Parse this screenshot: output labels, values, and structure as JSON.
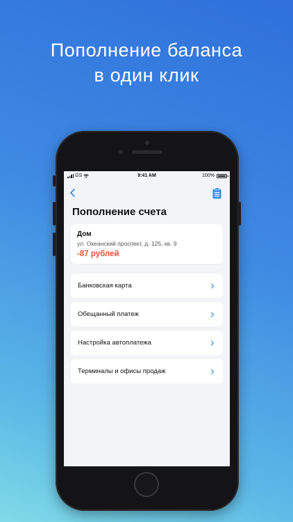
{
  "headline": {
    "line1": "Пополнение баланса",
    "line2": "в один клик"
  },
  "status_bar": {
    "carrier": "GS",
    "time": "9:41 AM",
    "battery": "100%"
  },
  "nav": {
    "back_icon": "chevron-left-icon",
    "action_icon": "clipboard-icon"
  },
  "page": {
    "title": "Пополнение счета"
  },
  "account": {
    "name": "Дом",
    "address": "ул. Океанский проспект, д. 125, кв. 9",
    "balance": "-87 рублей"
  },
  "menu": {
    "items": [
      {
        "label": "Банковская карта"
      },
      {
        "label": "Обещанный платеж"
      },
      {
        "label": "Настройка автоплатежа"
      },
      {
        "label": "Терминалы и офисы продаж"
      }
    ]
  },
  "colors": {
    "accent": "#3a8ee6",
    "negative_balance": "#e4503d",
    "screen_bg": "#f3f4f8"
  }
}
